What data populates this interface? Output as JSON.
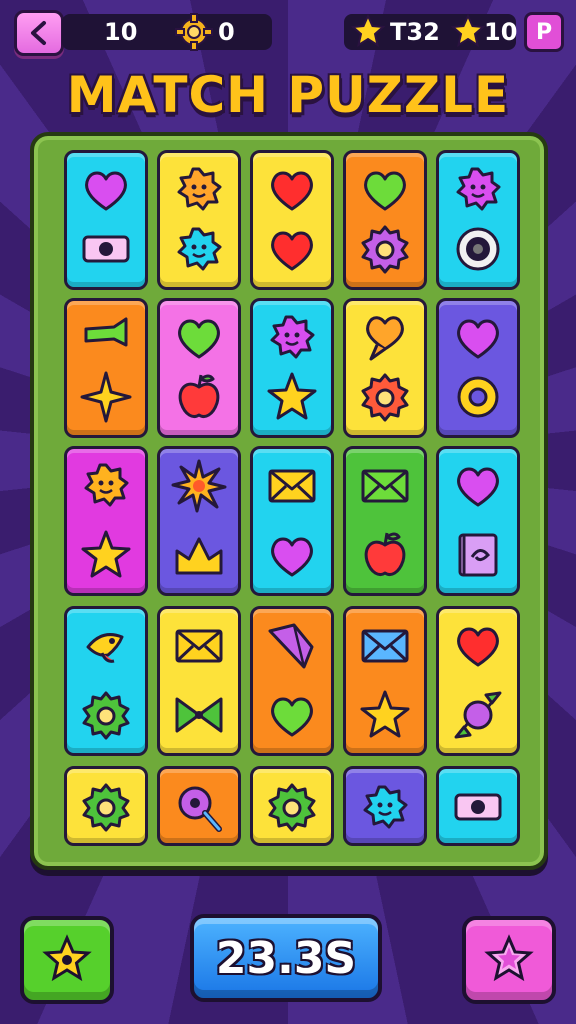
{
  "header": {
    "moves_value": "10",
    "coins_value": "0",
    "stars_value": "T32",
    "lives_value": "10",
    "pause_label": "P"
  },
  "title": "MATCH PUZZLE",
  "timer": "23.3S",
  "board": {
    "rows": [
      [
        {
          "color": "cyan",
          "icons": [
            "heart-icon",
            "cash-icon"
          ]
        },
        {
          "color": "yellow",
          "icons": [
            "blob-icon",
            "blob-icon"
          ]
        },
        {
          "color": "yellow",
          "icons": [
            "heart-icon",
            "heart-icon"
          ]
        },
        {
          "color": "orange",
          "icons": [
            "heart-icon",
            "flower-icon"
          ]
        },
        {
          "color": "cyan",
          "icons": [
            "blob-icon",
            "speaker-icon"
          ]
        }
      ],
      [
        {
          "color": "orange",
          "icons": [
            "tube-icon",
            "sparkle-icon"
          ]
        },
        {
          "color": "pink",
          "icons": [
            "heart-icon",
            "apple-icon"
          ]
        },
        {
          "color": "cyan",
          "icons": [
            "blob-icon",
            "star-icon"
          ]
        },
        {
          "color": "yellow",
          "icons": [
            "speech-heart-icon",
            "flower-icon"
          ]
        },
        {
          "color": "purple",
          "icons": [
            "heart-icon",
            "ring-icon"
          ]
        }
      ],
      [
        {
          "color": "magenta",
          "icons": [
            "blob-icon",
            "star-icon"
          ]
        },
        {
          "color": "purple",
          "icons": [
            "burst-icon",
            "crown-icon"
          ]
        },
        {
          "color": "cyan",
          "icons": [
            "envelope-icon",
            "heart-icon"
          ]
        },
        {
          "color": "green",
          "icons": [
            "envelope-icon",
            "apple-icon"
          ]
        },
        {
          "color": "cyan",
          "icons": [
            "heart-icon",
            "book-icon"
          ]
        }
      ],
      [
        {
          "color": "cyan",
          "icons": [
            "fish-icon",
            "flower-icon"
          ]
        },
        {
          "color": "yellow",
          "icons": [
            "envelope-icon",
            "bowtie-icon"
          ]
        },
        {
          "color": "orange",
          "icons": [
            "gem-icon",
            "heart-icon"
          ]
        },
        {
          "color": "orange",
          "icons": [
            "envelope-icon",
            "star-icon"
          ]
        },
        {
          "color": "yellow",
          "icons": [
            "heart-icon",
            "candy-icon"
          ]
        }
      ],
      [
        {
          "color": "yellow",
          "icons": [
            "flower-icon"
          ]
        },
        {
          "color": "orange",
          "icons": [
            "lollipop-icon"
          ]
        },
        {
          "color": "yellow",
          "icons": [
            "flower-icon"
          ]
        },
        {
          "color": "purple",
          "icons": [
            "blob-icon"
          ]
        },
        {
          "color": "cyan",
          "icons": [
            "cash-icon"
          ]
        }
      ]
    ]
  }
}
